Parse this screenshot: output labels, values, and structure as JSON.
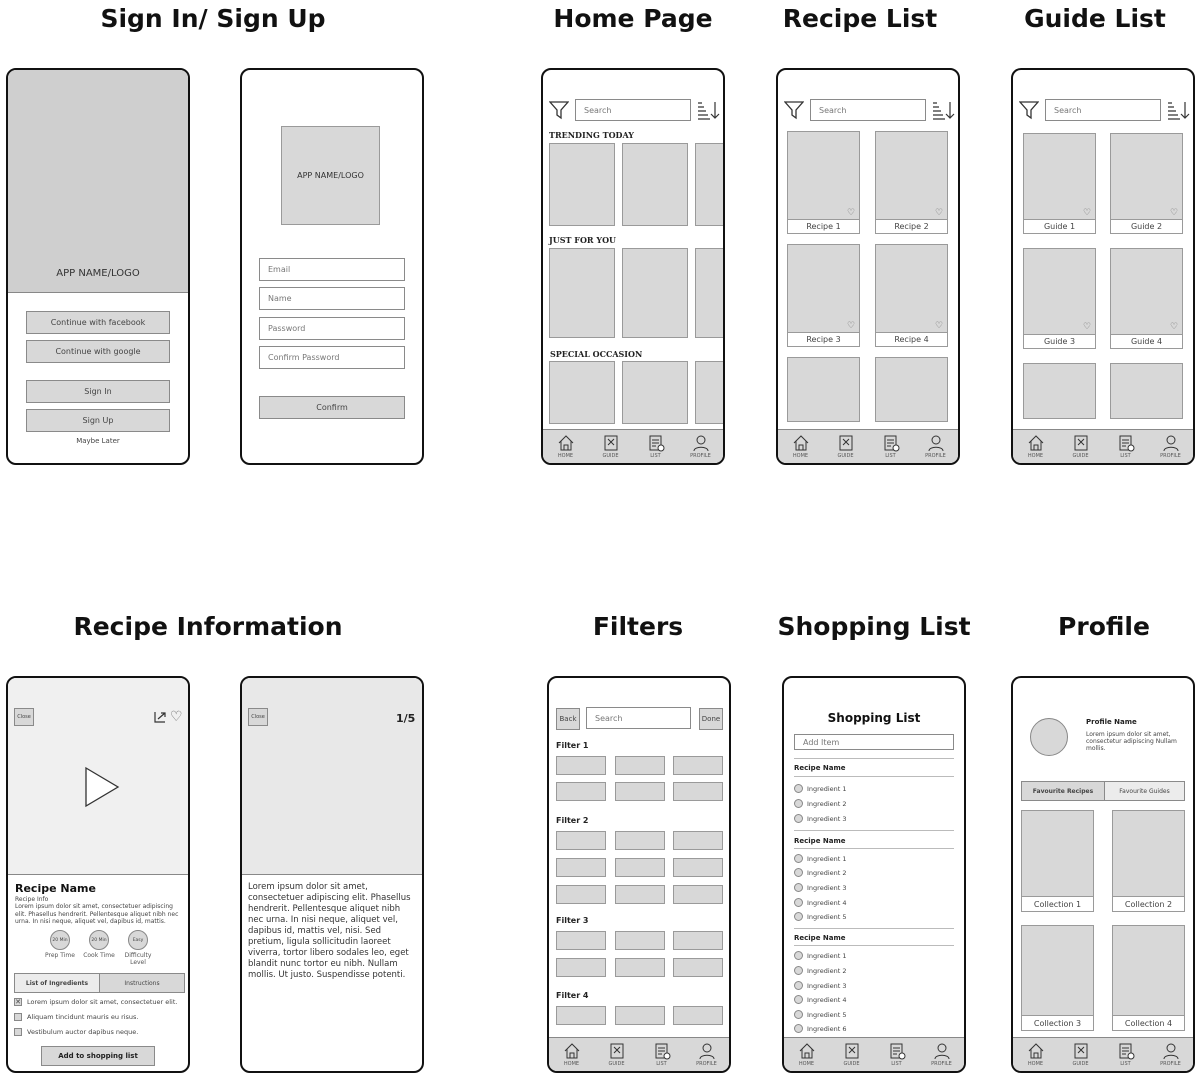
{
  "sections": {
    "signin": "Sign In/ Sign Up",
    "home": "Home Page",
    "recipe_list": "Recipe List",
    "guide_list": "Guide List",
    "recipe_info": "Recipe Information",
    "filters": "Filters",
    "shopping": "Shopping List",
    "profile": "Profile"
  },
  "signin1": {
    "logo": "APP NAME/LOGO",
    "facebook": "Continue with facebook",
    "google": "Continue with google",
    "signin": "Sign In",
    "signup": "Sign Up",
    "later": "Maybe Later"
  },
  "signup2": {
    "logo": "APP NAME/LOGO",
    "email": "Email",
    "name": "Name",
    "password": "Password",
    "confirm_password": "Confirm Password",
    "confirm": "Confirm"
  },
  "search": "Search",
  "home": {
    "trending": "TRENDING TODAY",
    "foryou": "JUST FOR YOU",
    "special": "SPECIAL OCCASION"
  },
  "nav": {
    "home": "HOME",
    "guide": "GUIDE",
    "list": "LIST",
    "profile": "PROFILE"
  },
  "recipes": [
    "Recipe 1",
    "Recipe 2",
    "Recipe 3",
    "Recipe 4"
  ],
  "guides": [
    "Guide 1",
    "Guide 2",
    "Guide 3",
    "Guide 4"
  ],
  "recipe_info": {
    "close": "Close",
    "name": "Recipe Name",
    "info": "Recipe Info",
    "desc": "Lorem ipsum dolor sit amet, consectetuer adipiscing elit. Phasellus hendrerit. Pellentesque aliquet nibh nec urna. In nisi neque, aliquet vel, dapibus id, mattis.",
    "prep_val": "20 Min",
    "prep_lbl": "Prep Time",
    "cook_val": "20 Min",
    "cook_lbl": "Cook Time",
    "diff_val": "Easy",
    "diff_lbl": "Difficulty Level",
    "tab_ingredients": "List of Ingredients",
    "tab_instructions": "Instructions",
    "items": [
      "Lorem ipsum dolor sit amet, consectetuer elit.",
      "Aliquam tincidunt mauris eu risus.",
      "Vestibulum auctor dapibus neque."
    ],
    "add": "Add to shopping list"
  },
  "instructions": {
    "close": "Close",
    "page": "1/5",
    "text": "Lorem ipsum dolor sit amet, consectetuer adipiscing elit. Phasellus hendrerit. Pellentesque aliquet nibh nec urna. In nisi neque, aliquet vel, dapibus id, mattis vel, nisi. Sed pretium, ligula sollicitudin laoreet viverra, tortor libero sodales leo, eget blandit nunc tortor eu nibh. Nullam mollis. Ut justo. Suspendisse potenti."
  },
  "filters": {
    "back": "Back",
    "done": "Done",
    "f1": "Filter 1",
    "f2": "Filter 2",
    "f3": "Filter 3",
    "f4": "Filter 4"
  },
  "shopping": {
    "title": "Shopping List",
    "add_placeholder": "Add Item",
    "recipe_name": "Recipe Name",
    "g1": [
      "Ingredient 1",
      "Ingredient 2",
      "Ingredient 3"
    ],
    "g2": [
      "Ingredient 1",
      "Ingredient 2",
      "Ingredient 3",
      "Ingredient 4",
      "Ingredient 5"
    ],
    "g3": [
      "Ingredient 1",
      "Ingredient 2",
      "Ingredient 3",
      "Ingredient 4",
      "Ingredient 5",
      "Ingredient 6"
    ]
  },
  "profile": {
    "name": "Profile Name",
    "bio": "Lorem ipsum dolor sit amet, consectetur adipiscing Nullam mollis.",
    "tab_fav_recipes": "Favourite Recipes",
    "tab_fav_guides": "Favourite Guides",
    "collections": [
      "Collection 1",
      "Collection 2",
      "Collection 3",
      "Collection 4"
    ]
  }
}
